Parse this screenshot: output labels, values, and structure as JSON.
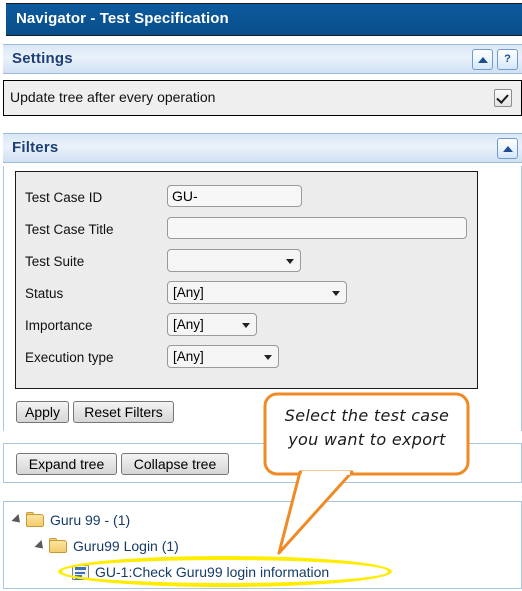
{
  "window": {
    "title": "Navigator - Test Specification"
  },
  "settings": {
    "header": "Settings",
    "collapse_icon": "triangle-up-icon",
    "help_label": "?",
    "option_label": "Update tree after every operation",
    "option_checked": true
  },
  "filters": {
    "header": "Filters",
    "collapse_icon": "triangle-up-icon",
    "fields": [
      {
        "label": "Test Case ID",
        "type": "text",
        "value": "GU-",
        "placeholder": ""
      },
      {
        "label": "Test Case Title",
        "type": "text",
        "value": "",
        "placeholder": ""
      },
      {
        "label": "Test Suite",
        "type": "select",
        "value": ""
      },
      {
        "label": "Status",
        "type": "select",
        "value": "[Any]"
      },
      {
        "label": "Importance",
        "type": "select",
        "value": "[Any]"
      },
      {
        "label": "Execution type",
        "type": "select",
        "value": "[Any]"
      }
    ],
    "buttons": {
      "apply": "Apply",
      "reset": "Reset Filters"
    }
  },
  "tree_toolbar": {
    "expand": "Expand tree",
    "collapse": "Collapse tree"
  },
  "tree": {
    "nodes": [
      {
        "label": "Guru 99 - (1)",
        "icon": "folder-icon",
        "twisty": "expanded",
        "depth": 0,
        "selected": false
      },
      {
        "label": "Guru99 Login (1)",
        "icon": "folder-icon",
        "twisty": "expanded",
        "depth": 1,
        "selected": false
      },
      {
        "label": "GU-1:Check Guru99 login information",
        "icon": "test-case-icon",
        "twisty": "none",
        "depth": 2,
        "selected": true
      }
    ]
  },
  "annotation": {
    "lines": [
      "Select the test case",
      "you want to export"
    ],
    "border_color": "#f08a24",
    "highlight_color": "#ffec00",
    "points_to": "GU-1:Check Guru99 login information"
  },
  "colors": {
    "titlebar": "#0b5394",
    "section_header_text": "#1f3f77",
    "panel_border": "#a8c6e6",
    "filters_bg": "#ececec"
  }
}
